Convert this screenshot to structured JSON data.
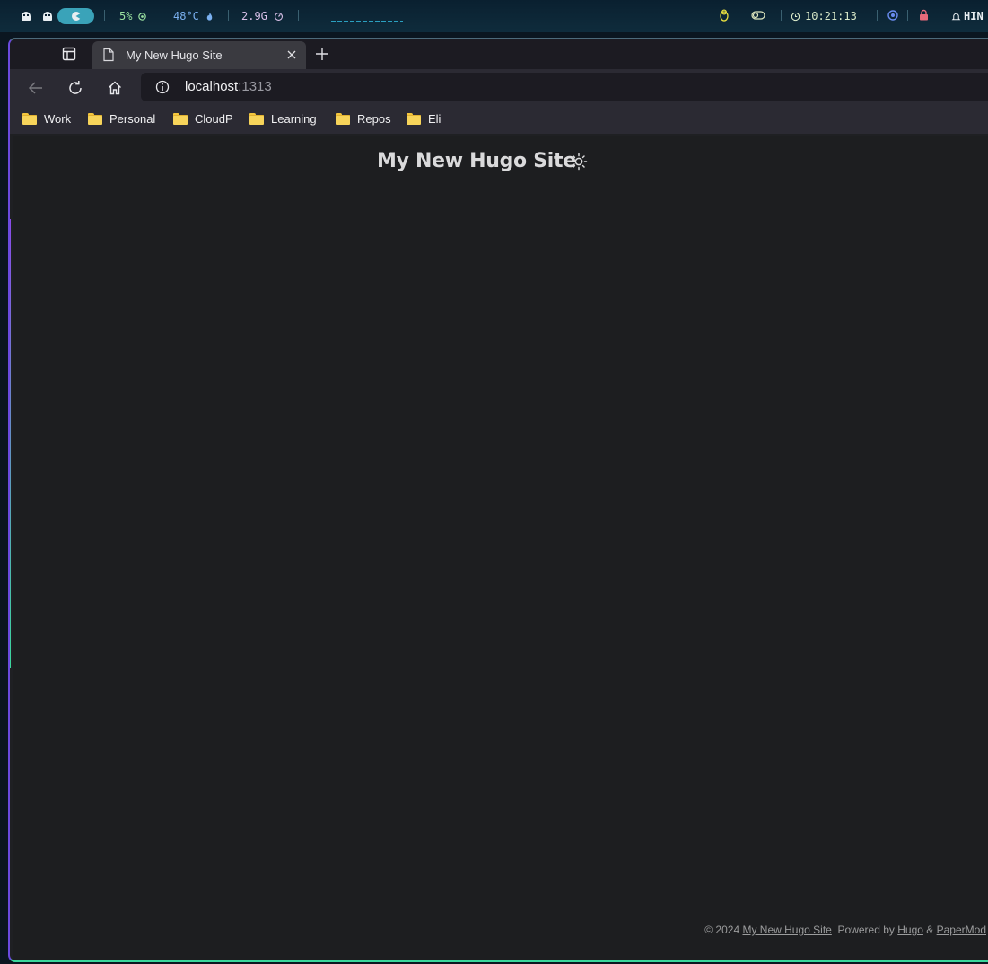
{
  "statusbar": {
    "cpu": "5%",
    "temp": "48°C",
    "memory": "2.9G",
    "time": "10:21:13",
    "right_label": "HIN"
  },
  "browser": {
    "tab_title": "My New Hugo Site",
    "url_host": "localhost",
    "url_port": ":1313",
    "bookmarks": [
      {
        "label": "Work",
        "icon": "folder-icon"
      },
      {
        "label": "Personal",
        "icon": "folder-icon"
      },
      {
        "label": "CloudP",
        "icon": "folder-icon"
      },
      {
        "label": "Learning",
        "icon": "folder-icon"
      },
      {
        "label": "Repos",
        "icon": "folder-icon"
      },
      {
        "label": "Eli",
        "icon": "folder-icon"
      }
    ]
  },
  "page": {
    "site_title": "My New Hugo Site",
    "theme_toggle_icon": "sun-icon",
    "footer": {
      "copyright": "© 2024",
      "site_link": "My New Hugo Site",
      "powered_by": "Powered by",
      "hugo_link": "Hugo",
      "ampersand": "&",
      "theme_link": "PaperMod"
    }
  },
  "colors": {
    "page_bg": "#1d1e20",
    "title": "#dadadb",
    "footer_text": "#9b9c9d",
    "accent_border": "#3bd69c"
  }
}
